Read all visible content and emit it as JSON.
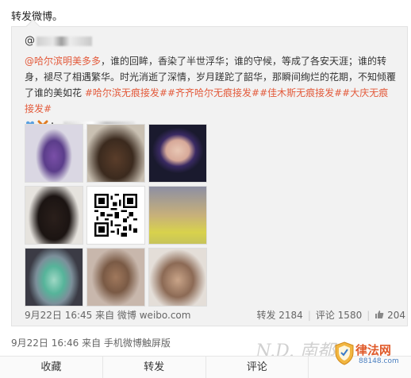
{
  "header": {
    "repost_label": "转发微博。"
  },
  "original_post": {
    "author_prefix": "@",
    "body_mention": "@哈尔滨明美多多",
    "body_text": "，谁的回眸，香染了半世浮华；谁的守候，等成了各安天涯；谁的转身，褪尽了相遇繁华。时光消逝了深情，岁月蹉跎了韶华，那瞬间绚烂的花期，不知倾覆了谁的美如花",
    "hashtags": "#哈尔滨无痕接发##齐齐哈尔无痕接发##佳木斯无痕接发##大庆无痕接发#",
    "emoji_icons": [
      "blue-heart-icon",
      "cross-icon"
    ],
    "thumbnails": [
      {
        "name": "purple-hair-thumb"
      },
      {
        "name": "brown-waves-thumb"
      },
      {
        "name": "blue-hair-selfie-thumb"
      },
      {
        "name": "black-hair-thumb"
      },
      {
        "name": "qr-code-thumb"
      },
      {
        "name": "yellow-ombre-thumb"
      },
      {
        "name": "green-ombre-thumb"
      },
      {
        "name": "curly-brown-thumb"
      },
      {
        "name": "model-portrait-thumb"
      }
    ],
    "footer_source": "9月22日 16:45 来自 微博 weibo.com",
    "stats": {
      "repost": "转发 2184",
      "comment": "评论 1580",
      "like": "204"
    }
  },
  "repost_meta": {
    "footer_source": "9月22日 16:46 来自 手机微博触屏版"
  },
  "actions": {
    "favorite": "收藏",
    "repost": "转发",
    "comment": "评论",
    "like": ""
  },
  "watermark": {
    "nd_text": "N.D. 南都",
    "logo_main": "律法网",
    "logo_sub": "88148.com"
  }
}
